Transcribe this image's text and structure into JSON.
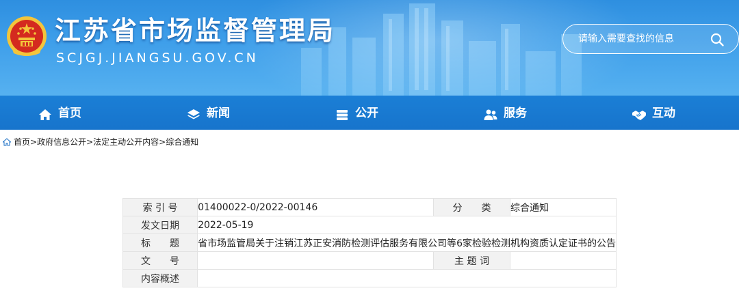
{
  "header": {
    "site_title": "江苏省市场监督管理局",
    "site_domain": "SCJGJ.JIANGSU.GOV.CN",
    "search_placeholder": "请输入需要查找的信息",
    "colors": {
      "banner": "#3a9ae8",
      "nav": "#1b7fd6",
      "emblem_red": "#d42a1f",
      "emblem_gold": "#f3c53b"
    }
  },
  "nav": {
    "items": [
      {
        "label": "首页",
        "icon": "home-icon"
      },
      {
        "label": "新闻",
        "icon": "layers-icon"
      },
      {
        "label": "公开",
        "icon": "stack-icon"
      },
      {
        "label": "服务",
        "icon": "people-icon"
      },
      {
        "label": "互动",
        "icon": "handshake-icon"
      }
    ]
  },
  "breadcrumb": {
    "icon": "home-icon",
    "items": [
      "首页",
      "政府信息公开",
      "法定主动公开内容",
      "综合通知"
    ],
    "separator": ">"
  },
  "info_table": {
    "rows": [
      {
        "label": "索 引 号",
        "value": "01400022-0/2022-00146",
        "label2": "分　　类",
        "value2": "综合通知"
      },
      {
        "label": "发文日期",
        "value": "2022-05-19"
      },
      {
        "label": "标　　题",
        "value": "省市场监管局关于注销江苏正安消防检测评估服务有限公司等6家检验检测机构资质认定证书的公告"
      },
      {
        "label": "文　　号",
        "value": "",
        "label2": "主 题 词",
        "value2": ""
      },
      {
        "label": "内容概述",
        "value": ""
      }
    ]
  }
}
